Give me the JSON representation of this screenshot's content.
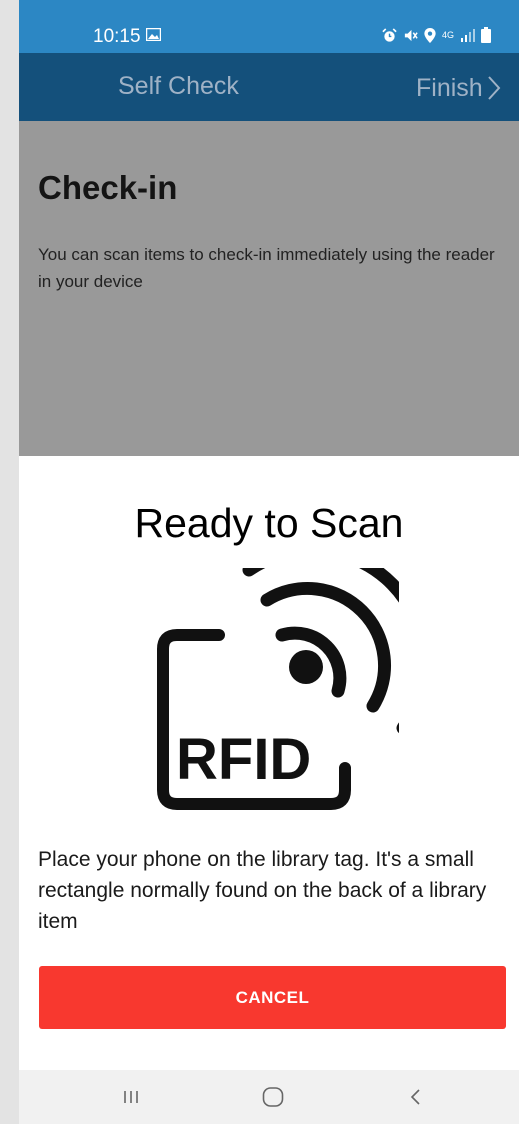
{
  "status_bar": {
    "time": "10:15",
    "network": "4G",
    "icons": [
      "gallery-icon",
      "alarm-icon",
      "mute-icon",
      "location-icon",
      "signal-icon",
      "battery-icon"
    ]
  },
  "app_bar": {
    "title": "Self Check",
    "finish_label": "Finish",
    "color": "#14507b"
  },
  "page": {
    "heading": "Check-in",
    "description": "You can scan items to check-in immediately using the reader in your device"
  },
  "sheet": {
    "title": "Ready to Scan",
    "icon_text": "RFID",
    "instruction": "Place your phone on the library tag. It's a small rectangle normally found on the back of a library item",
    "cancel_label": "CANCEL",
    "cancel_color": "#f8382f"
  },
  "nav_bar": {
    "buttons": [
      "recent-apps-icon",
      "home-icon",
      "back-icon"
    ]
  }
}
